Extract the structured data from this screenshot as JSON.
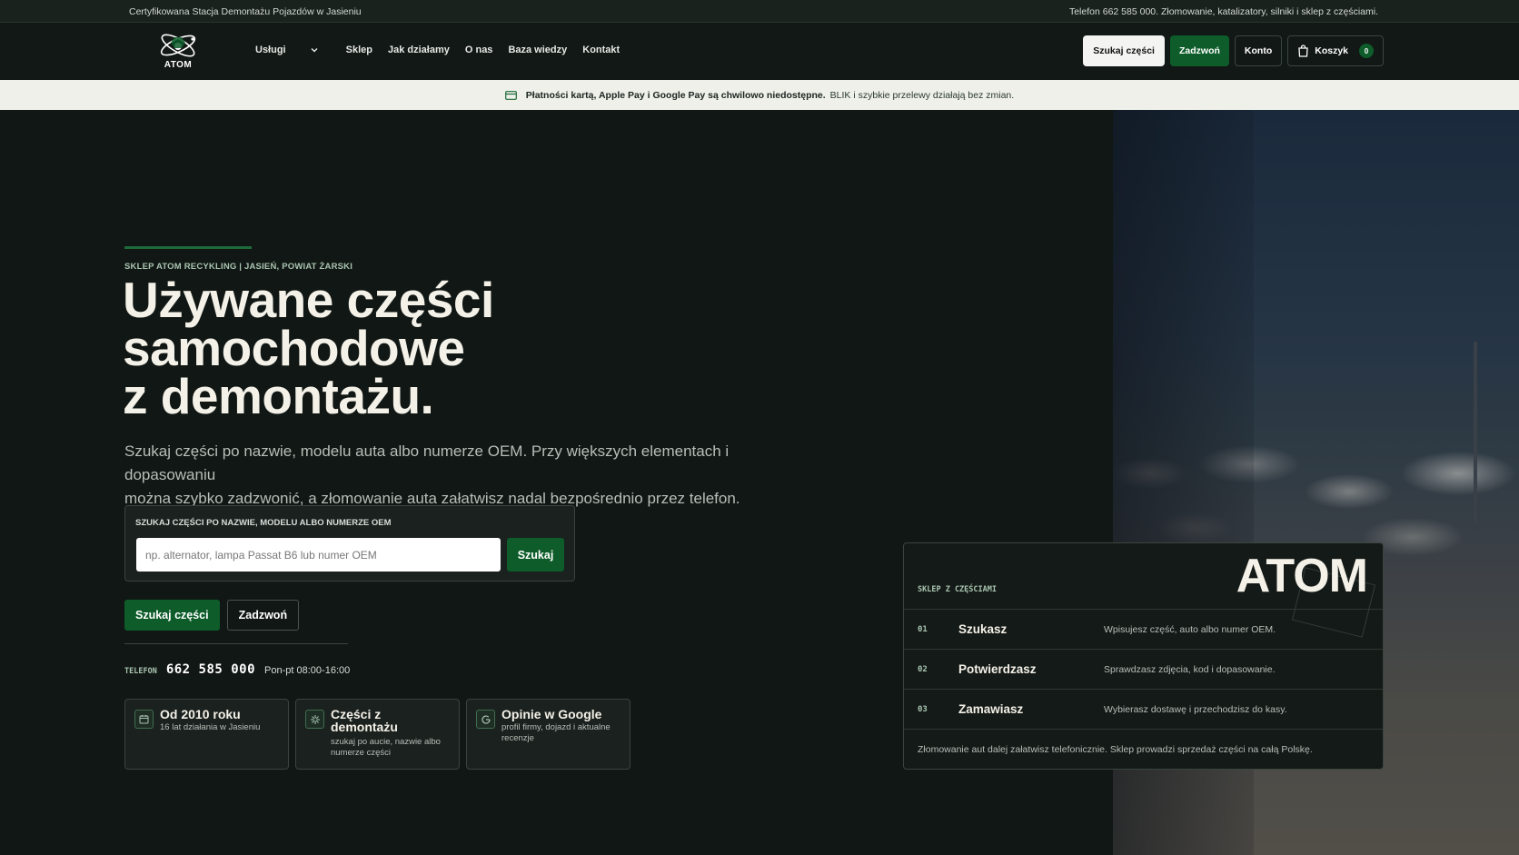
{
  "topbar": {
    "left": "Certyfikowana Stacja Demontażu Pojazdów w Jasieniu",
    "right": "Telefon 662 585 000. Złomowanie, katalizatory, silniki i sklep z częściami."
  },
  "nav": {
    "logo_text": "ATOM",
    "links": [
      "Usługi",
      "Sklep",
      "Jak działamy",
      "O nas",
      "Baza wiedzy",
      "Kontakt"
    ],
    "search_label": "Szukaj części",
    "call_label": "Zadzwoń",
    "account_label": "Konto",
    "cart_label": "Koszyk",
    "cart_count": "0"
  },
  "notice": {
    "bold": "Płatności kartą, Apple Pay i Google Pay są chwilowo niedostępne.",
    "rest": "BLIK i szybkie przelewy działają bez zmian."
  },
  "hero": {
    "eyebrow": "SKLEP ATOM RECYKLING | JASIEŃ, POWIAT ŻARSKI",
    "title_lines": [
      "Używane części",
      "samochodowe",
      "z demontażu."
    ],
    "desc_lines": [
      "Szukaj części po nazwie, modelu auta albo numerze OEM. Przy większych elementach i dopasowaniu",
      "można szybko zadzwonić, a złomowanie auta załatwisz nadal bezpośrednio przez telefon."
    ],
    "search": {
      "label": "SZUKAJ CZĘŚCI PO NAZWIE, MODELU ALBO NUMERZE OEM",
      "placeholder": "np. alternator, lampa Passat B6 lub numer OEM",
      "value": "",
      "button": "Szukaj"
    },
    "cta_primary": "Szukaj części",
    "cta_secondary": "Zadzwoń",
    "phone_label": "TELEFON",
    "phone_number": "662 585 000",
    "phone_hours": "Pon-pt 08:00-16:00",
    "features": [
      {
        "icon": "calendar-icon",
        "title_lines": [
          "Od 2010 roku"
        ],
        "sub_lines": [
          "16 lat działania w Jasieniu"
        ]
      },
      {
        "icon": "gear-icon",
        "title_lines": [
          "Części z",
          "demontażu"
        ],
        "sub_lines": [
          "szukaj po aucie, nazwie albo",
          "numerze części"
        ]
      },
      {
        "icon": "google-icon",
        "title_lines": [
          "Opinie w Google"
        ],
        "sub_lines": [
          "profil firmy, dojazd i aktualne",
          "recenzje"
        ]
      }
    ]
  },
  "card": {
    "label": "SKLEP Z CZĘŚCIAMI",
    "big": "ATOM",
    "steps": [
      {
        "num": "01",
        "title": "Szukasz",
        "desc": "Wpisujesz część, auto albo numer OEM."
      },
      {
        "num": "02",
        "title": "Potwierdzasz",
        "desc": "Sprawdzasz zdjęcia, kod i dopasowanie."
      },
      {
        "num": "03",
        "title": "Zamawiasz",
        "desc": "Wybierasz dostawę i przechodzisz do kasy."
      }
    ],
    "footer": "Złomowanie aut dalej załatwisz telefonicznie. Sklep prowadzi sprzedaż części na całą Polskę."
  },
  "colors": {
    "accent_green": "#0d5c2a",
    "background": "#111714",
    "notice_bg": "#eef0e9"
  }
}
